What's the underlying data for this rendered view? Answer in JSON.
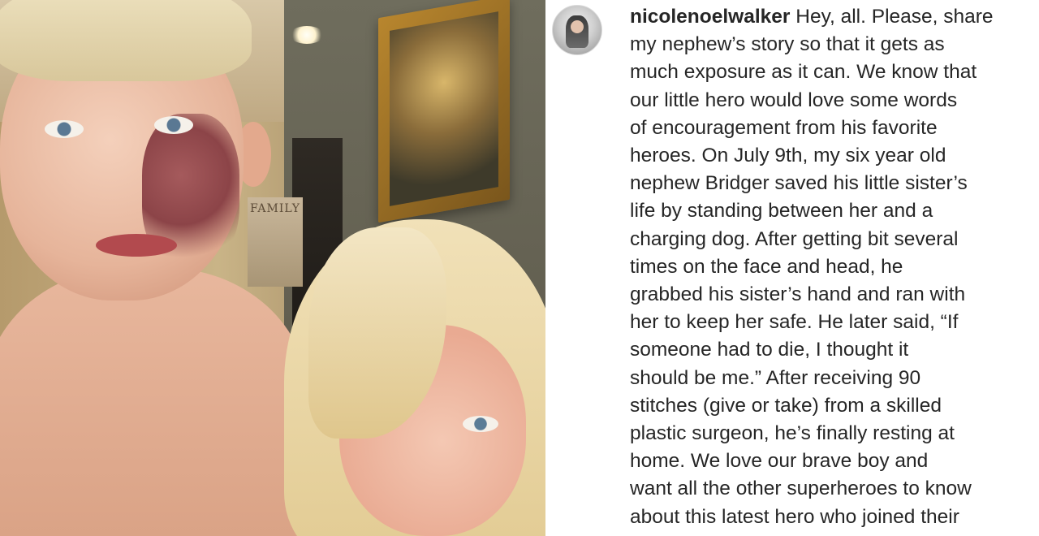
{
  "post": {
    "username": "nicolenoelwalker",
    "caption_lines": [
      " Hey, all. Please, share",
      "my nephew’s story so that it gets as",
      "much exposure as it can. We know that",
      "our little hero would love some words",
      "of encouragement from his favorite",
      "heroes. On July 9th, my six year old",
      "nephew Bridger saved his little sister’s",
      "life by standing between her and a",
      "charging dog. After getting bit several",
      "times on the face and head, he",
      "grabbed his sister’s hand and ran with",
      "her to keep her safe. He later said, “If",
      "someone had to die, I thought it",
      "should be me.” After receiving 90",
      "stitches (give or take) from a skilled",
      "plastic surgeon, he’s finally resting at",
      "home. We love our brave boy and",
      "want all the other superheroes to know",
      "about this latest hero who joined their"
    ]
  },
  "photo": {
    "wall_sign": "FAMILY"
  },
  "colors": {
    "text": "#262626",
    "background": "#ffffff"
  }
}
